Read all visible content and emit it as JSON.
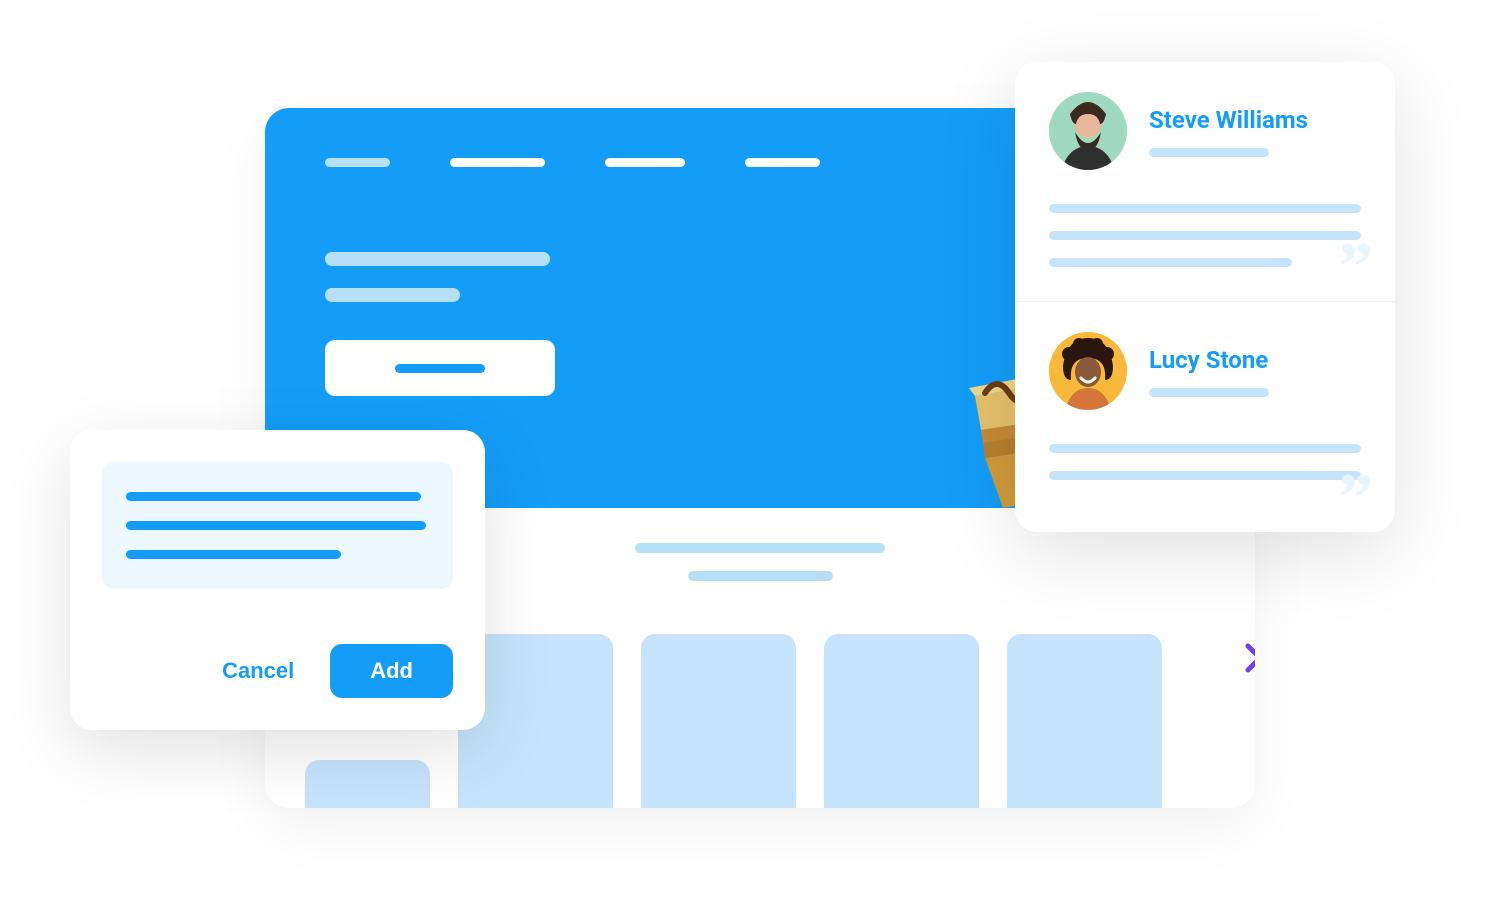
{
  "colors": {
    "primary": "#139df9",
    "pale": "#b6e0fa",
    "tile": "#c5e4fb",
    "accent_arrow": "#6f3ef5"
  },
  "dialog": {
    "cancel_label": "Cancel",
    "add_label": "Add"
  },
  "testimonials": [
    {
      "name": "Steve Williams",
      "avatar_bg": "#9fd9c1"
    },
    {
      "name": "Lucy Stone",
      "avatar_bg": "#f8b93a"
    }
  ]
}
